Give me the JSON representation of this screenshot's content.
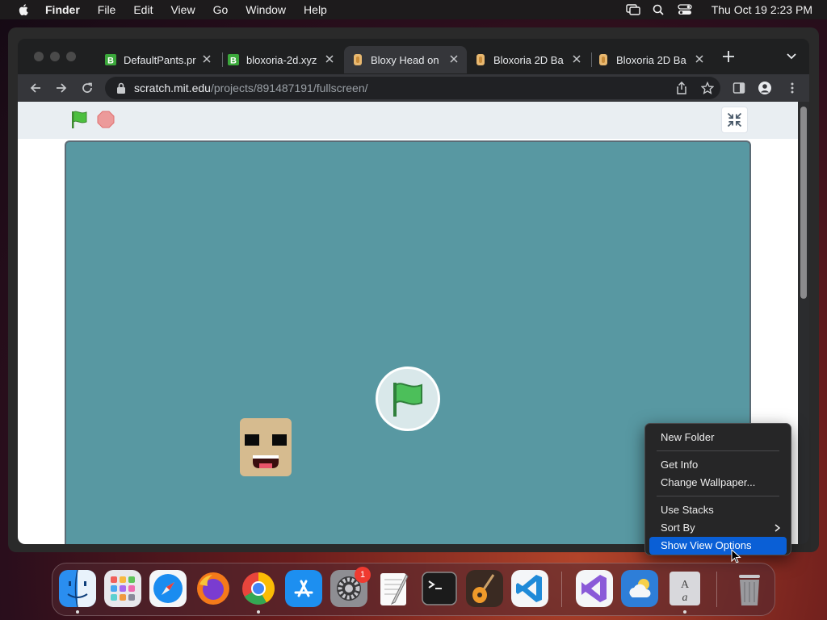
{
  "menubar": {
    "app_name": "Finder",
    "items": [
      "File",
      "Edit",
      "View",
      "Go",
      "Window",
      "Help"
    ],
    "clock": "Thu Oct 19  2:23 PM"
  },
  "browser": {
    "tabs": [
      {
        "title": "DefaultPants.pr",
        "favicon": "bloxoria-b-icon",
        "active": false
      },
      {
        "title": "bloxoria-2d.xyz",
        "favicon": "bloxoria-b-icon",
        "active": false
      },
      {
        "title": "Bloxy Head on",
        "favicon": "bloxy-head-icon",
        "active": true
      },
      {
        "title": "Bloxoria 2D Ba",
        "favicon": "bloxy-head-icon",
        "active": false
      },
      {
        "title": "Bloxoria 2D Ba",
        "favicon": "bloxy-head-icon",
        "active": false
      }
    ],
    "url": {
      "host": "scratch.mit.edu",
      "path": "/projects/891487191/fullscreen/"
    }
  },
  "context_menu": {
    "items": [
      {
        "label": "New Folder"
      },
      {
        "label": "Get Info"
      },
      {
        "label": "Change Wallpaper..."
      },
      {
        "label": "Use Stacks"
      },
      {
        "label": "Sort By",
        "submenu": true
      },
      {
        "label": "Show View Options",
        "highlighted": true
      }
    ]
  },
  "dock": {
    "apps": [
      "Finder",
      "Launchpad",
      "Safari",
      "Firefox",
      "Google Chrome",
      "App Store",
      "System Settings",
      "TextEdit",
      "Terminal",
      "GarageBand",
      "Visual Studio Code",
      "Visual Studio",
      "Weather",
      "Font Book",
      "Trash"
    ],
    "settings_badge": "1"
  },
  "colors": {
    "stage": "#5898a2",
    "highlight": "#0a5fd6",
    "menubar": "#1d1b1c"
  }
}
